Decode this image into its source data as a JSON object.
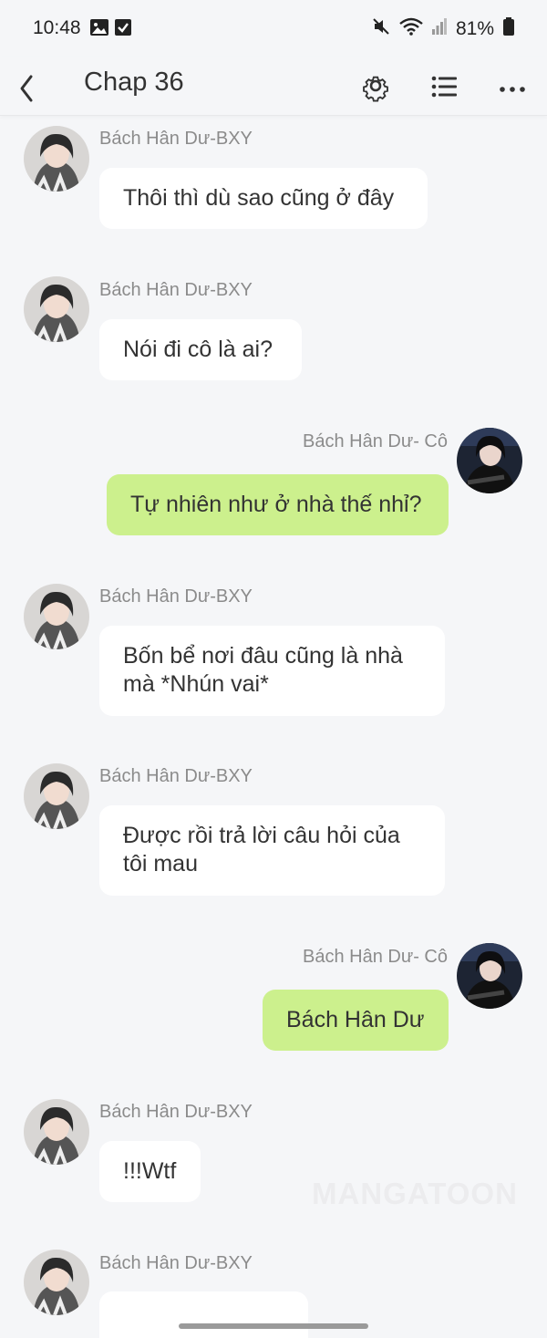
{
  "status_bar": {
    "time": "10:48",
    "battery": "81%"
  },
  "header": {
    "title": "Chap 36"
  },
  "messages": [
    {
      "side": "left",
      "author": "Bách Hân Dư-BXY",
      "text": "Thôi thì dù sao cũng ở đây"
    },
    {
      "side": "left",
      "author": "Bách Hân Dư-BXY",
      "text": "Nói đi cô là ai?"
    },
    {
      "side": "right",
      "author": "Bách Hân Dư- Cô",
      "text": "Tự nhiên như ở nhà thế nhỉ?"
    },
    {
      "side": "left",
      "author": "Bách Hân Dư-BXY",
      "text": "Bốn bể nơi đâu cũng là nhà mà *Nhún vai*"
    },
    {
      "side": "left",
      "author": "Bách Hân Dư-BXY",
      "text": "Được rồi trả lời câu hỏi của tôi mau"
    },
    {
      "side": "right",
      "author": "Bách Hân Dư- Cô",
      "text": "Bách Hân Dư"
    },
    {
      "side": "left",
      "author": "Bách Hân Dư-BXY",
      "text": "!!!Wtf"
    },
    {
      "side": "left",
      "author": "Bách Hân Dư-BXY",
      "text": ""
    }
  ],
  "watermark": "MANGATOON",
  "colors": {
    "background": "#f5f6f8",
    "bubble_left": "#ffffff",
    "bubble_right": "#ccf08d"
  }
}
